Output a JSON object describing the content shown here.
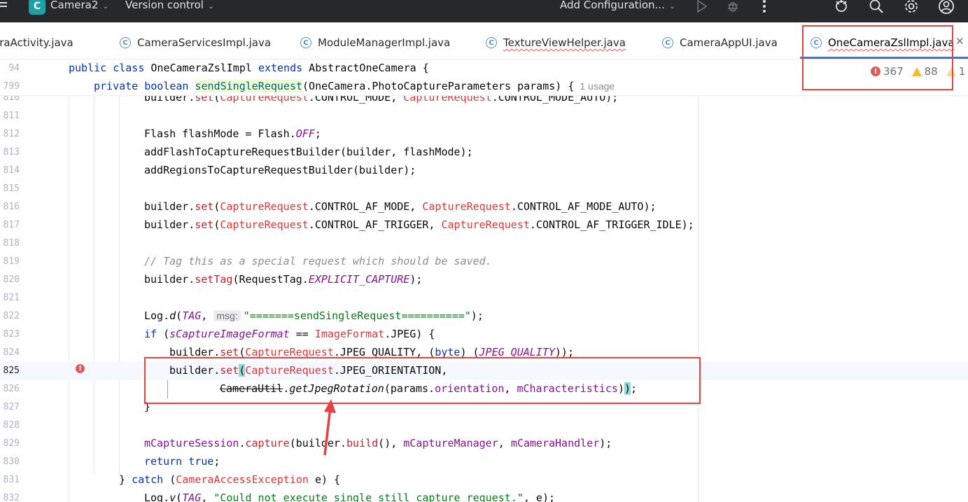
{
  "topbar": {
    "project_badge": "C",
    "project_name": "Camera2",
    "vcs_label": "Version control",
    "run_config_label": "Add Configuration..."
  },
  "tabs": [
    {
      "label": "eraActivity.java"
    },
    {
      "label": "CameraServicesImpl.java"
    },
    {
      "label": "ModuleManagerImpl.java"
    },
    {
      "label": "TextureViewHelper.java"
    },
    {
      "label": "CameraAppUI.java"
    },
    {
      "label": "OneCameraZslImpl.java",
      "active": true
    }
  ],
  "inspections": {
    "errors": "367",
    "warnings": "88",
    "weak_warnings": "1"
  },
  "sticky": [
    {
      "ln": "94",
      "text": "public class OneCameraZslImpl extends AbstractOneCamera {"
    },
    {
      "ln": "799",
      "text": "private boolean sendSingleRequest(OneCamera.PhotoCaptureParameters params) {",
      "usage": "1 usage"
    }
  ],
  "code_lines": [
    {
      "ln": "810",
      "text": "builder.set(CaptureRequest.CONTROL_MODE, CaptureRequest.CONTROL_MODE_AUTO);"
    },
    {
      "ln": "811",
      "text": ""
    },
    {
      "ln": "812",
      "text": "Flash flashMode = Flash.OFF;"
    },
    {
      "ln": "813",
      "text": "addFlashToCaptureRequestBuilder(builder, flashMode);"
    },
    {
      "ln": "814",
      "text": "addRegionsToCaptureRequestBuilder(builder);"
    },
    {
      "ln": "815",
      "text": ""
    },
    {
      "ln": "816",
      "text": "builder.set(CaptureRequest.CONTROL_AF_MODE, CaptureRequest.CONTROL_AF_MODE_AUTO);"
    },
    {
      "ln": "817",
      "text": "builder.set(CaptureRequest.CONTROL_AF_TRIGGER, CaptureRequest.CONTROL_AF_TRIGGER_IDLE);"
    },
    {
      "ln": "818",
      "text": ""
    },
    {
      "ln": "819",
      "text": "// Tag this as a special request which should be saved."
    },
    {
      "ln": "820",
      "text": "builder.setTag(RequestTag.EXPLICIT_CAPTURE);"
    },
    {
      "ln": "821",
      "text": ""
    },
    {
      "ln": "822",
      "text": "Log.d(TAG, msg: \"=======sendSingleRequest==========\");",
      "hint": "msg:"
    },
    {
      "ln": "823",
      "text": "if (sCaptureImageFormat == ImageFormat.JPEG) {"
    },
    {
      "ln": "824",
      "text": "builder.set(CaptureRequest.JPEG_QUALITY, (byte) (JPEG_QUALITY));"
    },
    {
      "ln": "825",
      "text": "builder.set(CaptureRequest.JPEG_ORIENTATION,"
    },
    {
      "ln": "826",
      "text": "CameraUtil.getJpegRotation(params.orientation, mCharacteristics));"
    },
    {
      "ln": "827",
      "text": "}"
    },
    {
      "ln": "828",
      "text": ""
    },
    {
      "ln": "829",
      "text": "mCaptureSession.capture(builder.build(), mCaptureManager, mCameraHandler);"
    },
    {
      "ln": "830",
      "text": "return true;"
    },
    {
      "ln": "831",
      "text": "} catch (CameraAccessException e) {"
    },
    {
      "ln": "832",
      "text": "Log.v(TAG, \"Could not execute single still capture request.\", e);"
    }
  ],
  "colors": {
    "annotation_red": "#e64141",
    "tab_accent": "#3574f0",
    "error": "#db5c5c",
    "warning": "#f2b93b"
  }
}
